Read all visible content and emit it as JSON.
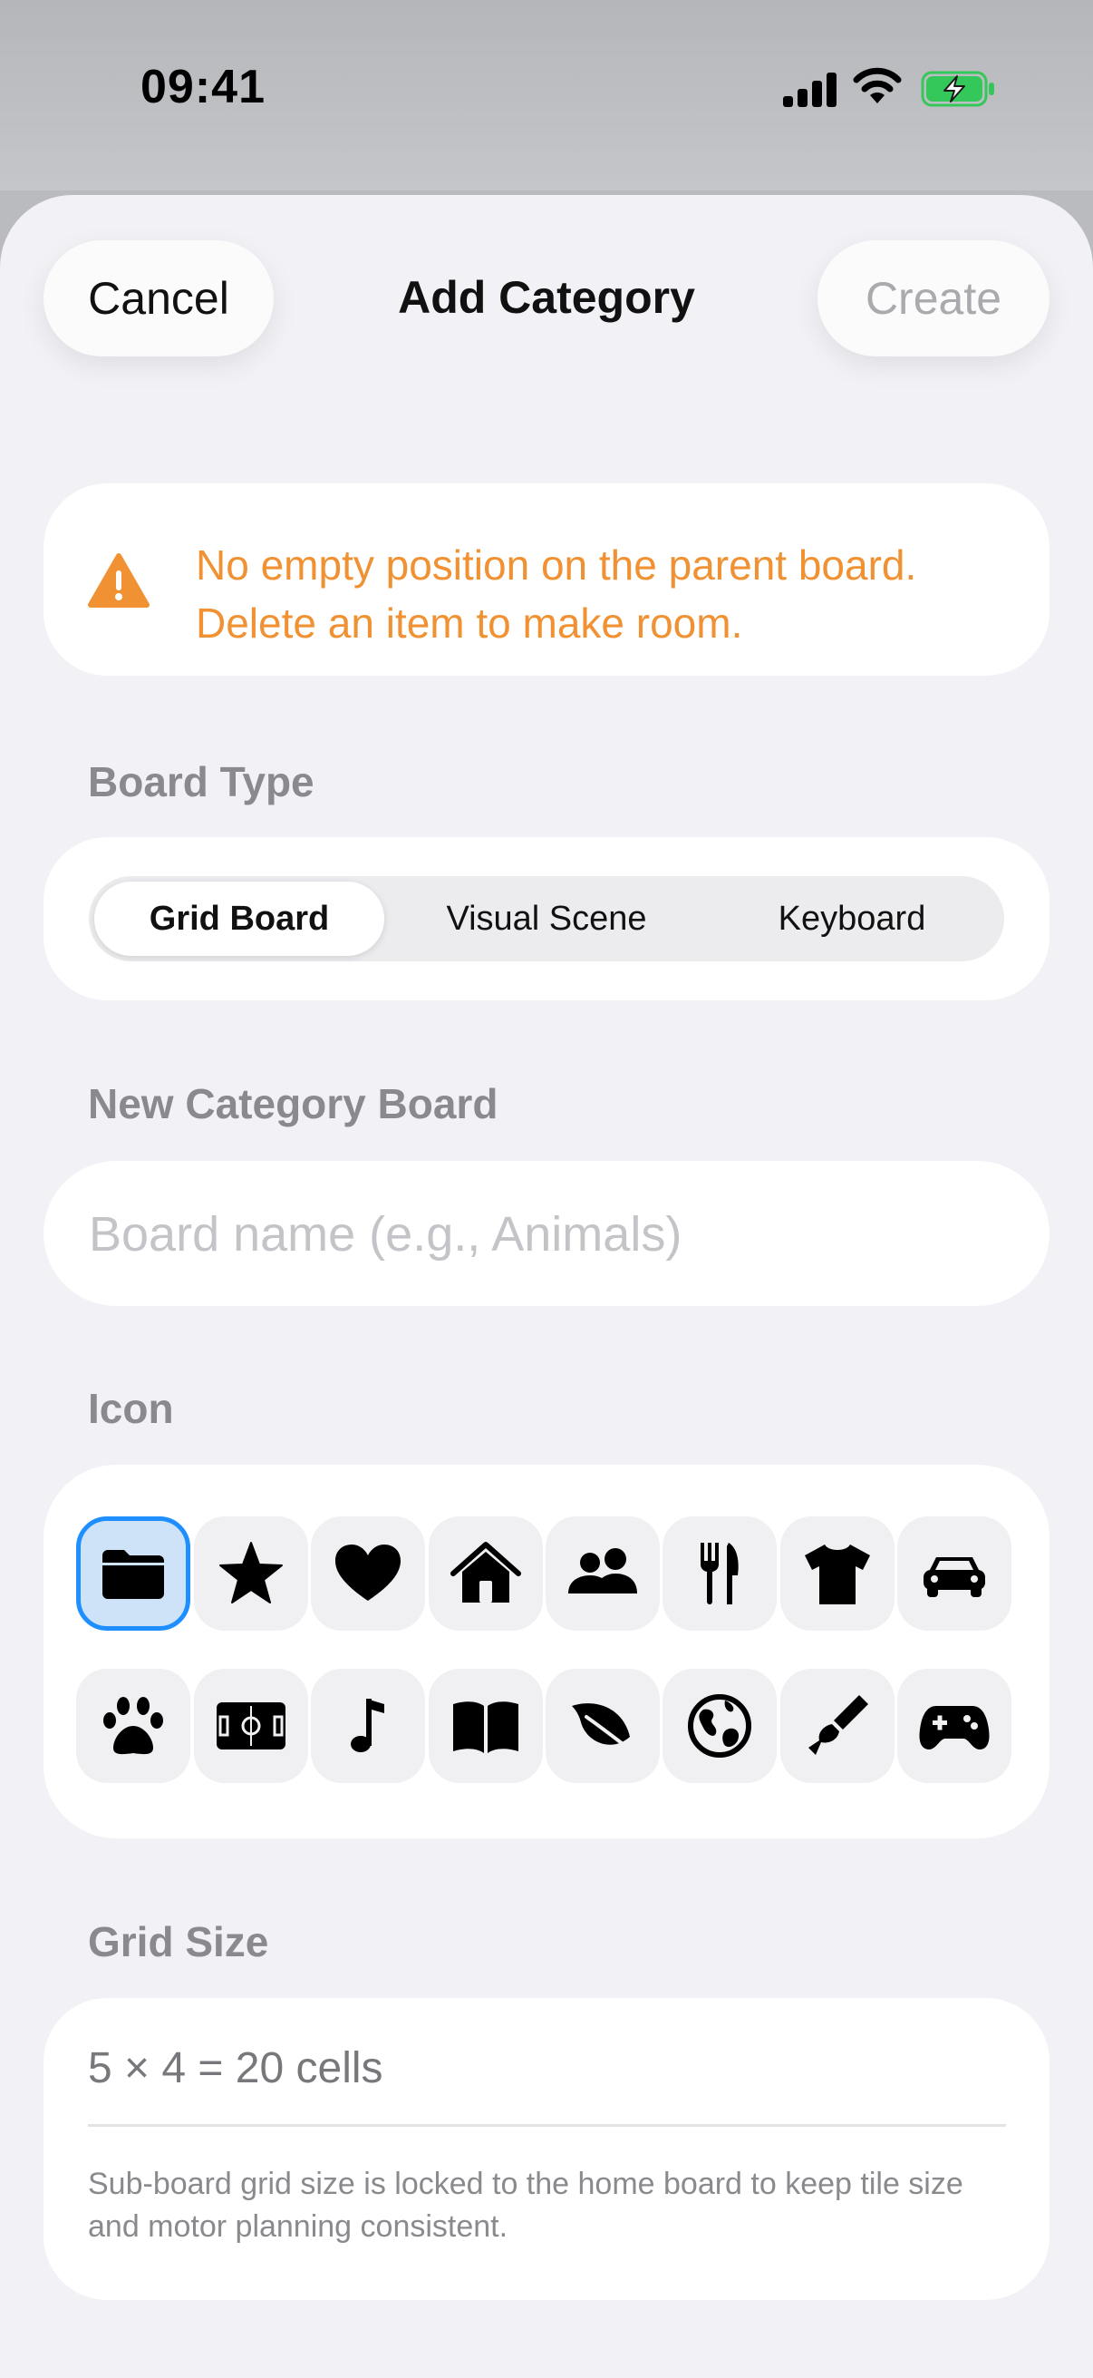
{
  "status_bar": {
    "time": "09:41"
  },
  "header": {
    "cancel_label": "Cancel",
    "title": "Add Category",
    "create_label": "Create"
  },
  "warning": {
    "icon": "exclamation-triangle-icon",
    "message": "No empty position on the parent board. Delete an item to make room."
  },
  "board_type": {
    "label": "Board Type",
    "options": [
      "Grid Board",
      "Visual Scene",
      "Keyboard"
    ],
    "selected": "Grid Board"
  },
  "name_field": {
    "label": "New Category Board",
    "placeholder": "Board name (e.g., Animals)",
    "value": ""
  },
  "icon_section": {
    "label": "Icon",
    "selected": "folder",
    "icons": [
      "folder",
      "star",
      "heart",
      "house",
      "people",
      "fork-knife",
      "tshirt",
      "car",
      "pawprint",
      "soccer-field",
      "music-note",
      "book",
      "leaf",
      "globe",
      "paintbrush",
      "gamecontroller"
    ]
  },
  "grid_size": {
    "label": "Grid Size",
    "value": "5 × 4 = 20 cells",
    "note": "Sub-board grid size is locked to the home board to keep tile size and motor planning consistent."
  },
  "colors": {
    "warning": "#F09233",
    "accent": "#1F8FFF",
    "secondary_text": "#8A8A8E",
    "battery_green": "#34C759"
  }
}
